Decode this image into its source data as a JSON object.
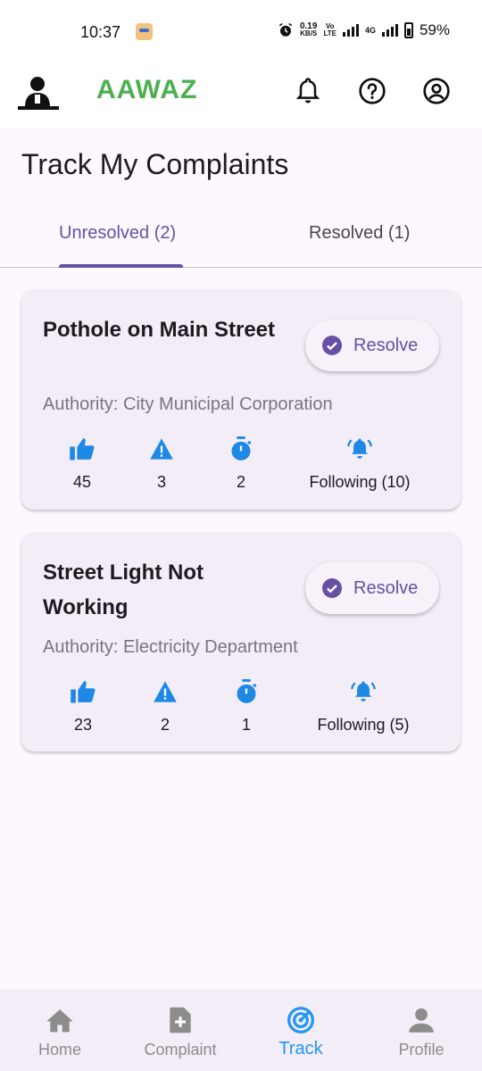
{
  "status_bar": {
    "time": "10:37",
    "net_speed_value": "0.19",
    "net_speed_unit": "KB/S",
    "volte_top": "Vo",
    "volte_bottom": "LTE",
    "network": "4G",
    "battery": "59%"
  },
  "app_bar": {
    "brand": "AAWAZ",
    "brand_color": "#4caf50",
    "icons": [
      "notifications-icon",
      "help-icon",
      "account-icon"
    ]
  },
  "page": {
    "title": "Track My Complaints"
  },
  "tabs": [
    {
      "label": "Unresolved (2)",
      "active": true
    },
    {
      "label": "Resolved (1)",
      "active": false
    }
  ],
  "complaints": [
    {
      "title": "Pothole on Main Street",
      "resolve_label": "Resolve",
      "authority": "Authority: City Municipal Corporation",
      "upvotes": "45",
      "warnings": "3",
      "timer": "2",
      "following": "Following (10)"
    },
    {
      "title": "Street Light Not Working",
      "resolve_label": "Resolve",
      "authority": "Authority: Electricity Department",
      "upvotes": "23",
      "warnings": "2",
      "timer": "1",
      "following": "Following (5)"
    }
  ],
  "bottom_nav": [
    {
      "label": "Home",
      "icon": "home-icon",
      "active": false
    },
    {
      "label": "Complaint",
      "icon": "add-document-icon",
      "active": false
    },
    {
      "label": "Track",
      "icon": "track-radar-icon",
      "active": true
    },
    {
      "label": "Profile",
      "icon": "person-icon",
      "active": false
    }
  ],
  "colors": {
    "primary": "#6750a4",
    "accent_blue": "#2196f3",
    "background": "#fdf7fe",
    "card": "#f3edf7"
  }
}
